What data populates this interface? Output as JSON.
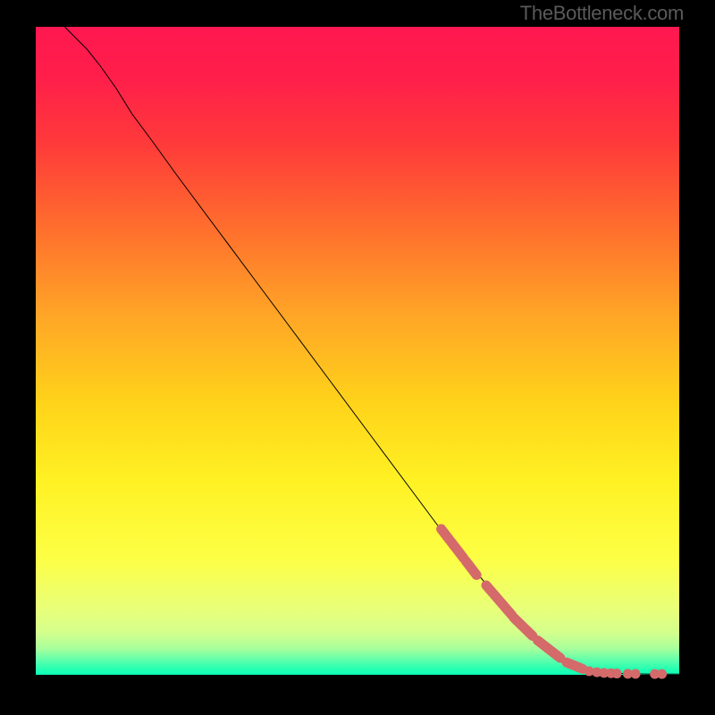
{
  "attribution": "TheBottleneck.com",
  "chart_data": {
    "type": "line",
    "title": "",
    "xlabel": "",
    "ylabel": "",
    "xlim": [
      0,
      100
    ],
    "ylim": [
      0,
      100
    ],
    "gradient_stops": [
      {
        "pos": 0.0,
        "color": "#ff1850"
      },
      {
        "pos": 0.08,
        "color": "#ff1f4a"
      },
      {
        "pos": 0.18,
        "color": "#ff3a3a"
      },
      {
        "pos": 0.3,
        "color": "#ff6a2e"
      },
      {
        "pos": 0.45,
        "color": "#ffa726"
      },
      {
        "pos": 0.58,
        "color": "#ffd31a"
      },
      {
        "pos": 0.7,
        "color": "#fff123"
      },
      {
        "pos": 0.82,
        "color": "#fdff45"
      },
      {
        "pos": 0.9,
        "color": "#e8ff7a"
      },
      {
        "pos": 0.935,
        "color": "#d4ff8c"
      },
      {
        "pos": 0.96,
        "color": "#a6ff9c"
      },
      {
        "pos": 0.978,
        "color": "#5cffac"
      },
      {
        "pos": 0.99,
        "color": "#2affb0"
      },
      {
        "pos": 1.0,
        "color": "#0affb8"
      }
    ],
    "curve": [
      {
        "x": 4.5,
        "y": 100.0
      },
      {
        "x": 6.0,
        "y": 98.5
      },
      {
        "x": 8.0,
        "y": 96.5
      },
      {
        "x": 10.0,
        "y": 94.0
      },
      {
        "x": 12.5,
        "y": 90.5
      },
      {
        "x": 15.0,
        "y": 86.5
      },
      {
        "x": 18.0,
        "y": 82.5
      },
      {
        "x": 22.0,
        "y": 77.0
      },
      {
        "x": 28.0,
        "y": 69.0
      },
      {
        "x": 34.0,
        "y": 61.0
      },
      {
        "x": 40.0,
        "y": 53.0
      },
      {
        "x": 46.0,
        "y": 45.0
      },
      {
        "x": 52.0,
        "y": 37.0
      },
      {
        "x": 58.0,
        "y": 29.0
      },
      {
        "x": 64.0,
        "y": 21.0
      },
      {
        "x": 70.0,
        "y": 14.0
      },
      {
        "x": 75.0,
        "y": 8.5
      },
      {
        "x": 80.0,
        "y": 4.0
      },
      {
        "x": 84.0,
        "y": 1.5
      },
      {
        "x": 88.0,
        "y": 0.4
      },
      {
        "x": 92.0,
        "y": 0.15
      },
      {
        "x": 96.0,
        "y": 0.1
      },
      {
        "x": 100.0,
        "y": 0.1
      }
    ],
    "marker_segments": [
      {
        "x1": 63.0,
        "y1": 22.5,
        "x2": 66.5,
        "y2": 18.0
      },
      {
        "x1": 66.8,
        "y1": 17.6,
        "x2": 68.5,
        "y2": 15.4
      },
      {
        "x1": 70.0,
        "y1": 13.8,
        "x2": 74.0,
        "y2": 9.2
      },
      {
        "x1": 74.3,
        "y1": 8.8,
        "x2": 77.2,
        "y2": 6.0
      },
      {
        "x1": 78.0,
        "y1": 5.3,
        "x2": 81.5,
        "y2": 2.6
      },
      {
        "x1": 82.5,
        "y1": 1.9,
        "x2": 85.0,
        "y2": 0.9
      }
    ],
    "marker_dots": [
      {
        "x": 86.0,
        "y": 0.55
      },
      {
        "x": 87.2,
        "y": 0.4
      },
      {
        "x": 88.3,
        "y": 0.3
      },
      {
        "x": 89.4,
        "y": 0.25
      },
      {
        "x": 90.3,
        "y": 0.2
      },
      {
        "x": 92.0,
        "y": 0.15
      },
      {
        "x": 93.2,
        "y": 0.14
      },
      {
        "x": 96.2,
        "y": 0.12
      },
      {
        "x": 97.3,
        "y": 0.12
      }
    ],
    "marker_color": "#d46a6a",
    "marker_radius": 5.5,
    "curve_color": "#000000",
    "curve_width": 1.0
  }
}
